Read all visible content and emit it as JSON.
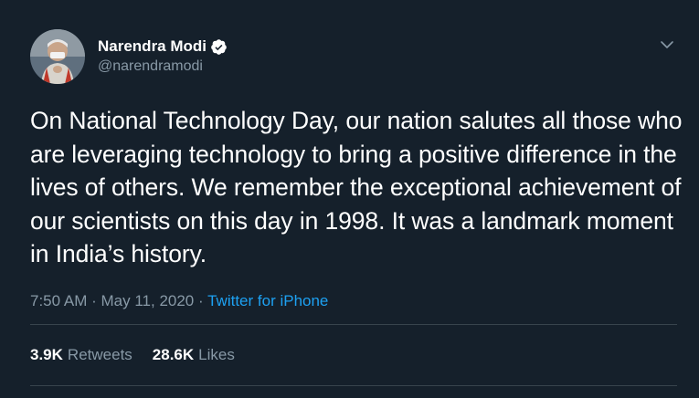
{
  "author": {
    "display_name": "Narendra Modi",
    "handle": "@narendramodi",
    "verified": true
  },
  "tweet": {
    "text": "On National Technology Day, our nation salutes all those who are leveraging technology to bring a positive difference in the lives of others. We remember the exceptional achievement of our scientists on this day in 1998. It was a landmark moment in India’s history.",
    "time": "7:50 AM",
    "separator": "·",
    "date": "May 11, 2020",
    "source": "Twitter for iPhone"
  },
  "stats": {
    "retweets_count": "3.9K",
    "retweets_label": "Retweets",
    "likes_count": "28.6K",
    "likes_label": "Likes"
  },
  "colors": {
    "background": "#15202b",
    "text_primary": "#ffffff",
    "text_secondary": "#8899a6",
    "accent": "#1da1f2",
    "divider": "#38444d"
  },
  "icons": {
    "verified": "verified-badge-icon",
    "menu": "chevron-down-icon"
  }
}
